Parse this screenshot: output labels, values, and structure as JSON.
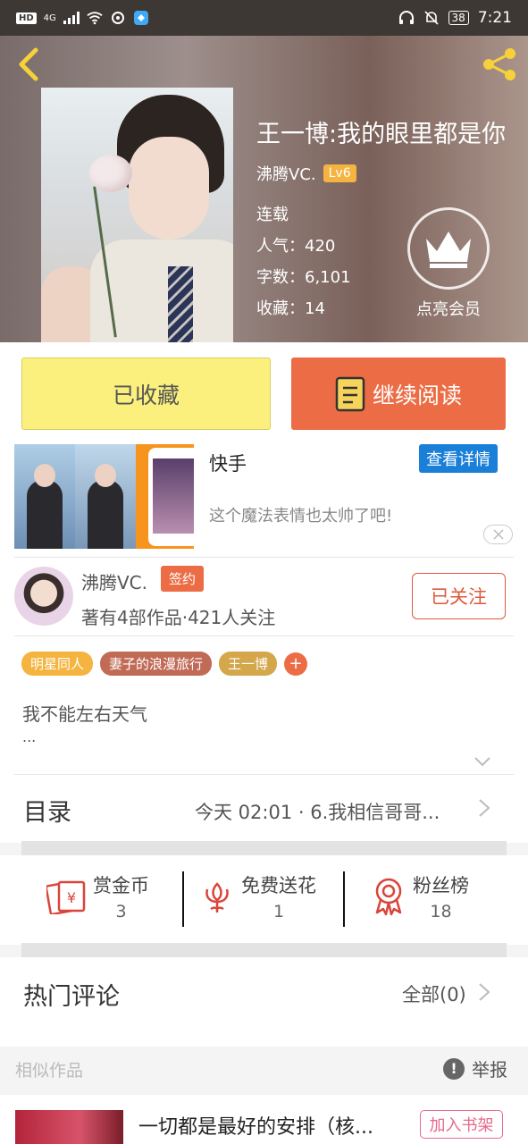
{
  "status_bar": {
    "hd": "HD",
    "network": "4G",
    "battery": "38",
    "time": "7:21"
  },
  "book": {
    "title": "王一博:我的眼里都是你",
    "author": "沸腾VC.",
    "level": "Lv6",
    "status": "连载",
    "popularity_label": "人气：",
    "popularity": "420",
    "words_label": "字数：",
    "words": "6,101",
    "favorites_label": "收藏：",
    "favorites": "14",
    "vip_label": "点亮会员"
  },
  "actions": {
    "favorited_label": "已收藏",
    "continue_label": "继续阅读"
  },
  "ad": {
    "title": "快手",
    "detail_label": "查看详情",
    "description": "这个魔法表情也太帅了吧!"
  },
  "author_card": {
    "name": "沸腾VC.",
    "badge": "签约",
    "stats": "著有4部作品·421人关注",
    "follow_label": "已关注"
  },
  "tags": [
    {
      "label": "明星同人",
      "color": "#f4b43f"
    },
    {
      "label": "妻子的浪漫旅行",
      "color": "#c16b57"
    },
    {
      "label": "王一博",
      "color": "#d4a74b"
    }
  ],
  "tag_add": "+",
  "intro": {
    "text": "我不能左右天气",
    "more": "..."
  },
  "catalog": {
    "label": "目录",
    "latest": "今天 02:01 · 6.我相信哥哥..."
  },
  "support": {
    "coins_label": "赏金币",
    "coins": "3",
    "flowers_label": "免费送花",
    "flowers": "1",
    "fans_label": "粉丝榜",
    "fans": "18"
  },
  "comments": {
    "label": "热门评论",
    "all_label": "全部(0)"
  },
  "similar": {
    "label": "相似作品",
    "report_label": "举报",
    "items": [
      {
        "title": "一切都是最好的安排（核...",
        "button": "加入书架"
      }
    ]
  },
  "colors": {
    "accent": "#ec6d45",
    "favorite_yellow": "#fbf07d",
    "ad_blue": "#1a7fd8"
  }
}
